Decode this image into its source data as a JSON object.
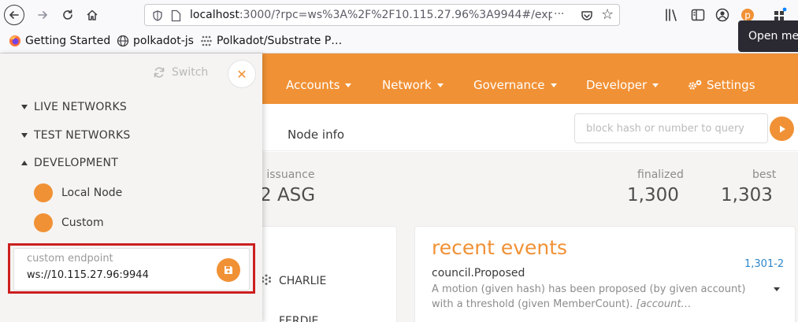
{
  "browser": {
    "url_host": "localhost",
    "url_rest": ":3000/?rpc=ws%3A%2F%2F10.115.27.96%3A9944#/exp",
    "bookmarks": [
      {
        "label": "Getting Started"
      },
      {
        "label": "polkadot-js"
      },
      {
        "label": "Polkadot/Substrate P…"
      }
    ],
    "tooltip": "Open menu"
  },
  "header": {
    "menu": [
      {
        "label": "Accounts"
      },
      {
        "label": "Network"
      },
      {
        "label": "Governance"
      },
      {
        "label": "Developer"
      },
      {
        "label": "Settings"
      }
    ]
  },
  "subbar": {
    "tab": "Node info",
    "search_placeholder": "block hash or number to query"
  },
  "stats": {
    "issuance_label": "l issuance",
    "issuance_value": "2 ASG",
    "finalized_label": "finalized",
    "finalized_value": "1,300",
    "best_label": "best",
    "best_value": "1,303"
  },
  "accounts": [
    "CHARLIE",
    "FERDIE"
  ],
  "events": {
    "title": "recent events",
    "items": [
      {
        "name": "council.Proposed",
        "block": "1,301-2",
        "description": "A motion (given hash) has been proposed (by given account) with a threshold (given MemberCount).",
        "params": "[account…"
      }
    ]
  },
  "panel": {
    "switch_label": "Switch",
    "groups": [
      {
        "label": "LIVE NETWORKS",
        "expanded": false
      },
      {
        "label": "TEST NETWORKS",
        "expanded": false
      },
      {
        "label": "DEVELOPMENT",
        "expanded": true
      }
    ],
    "dev_items": [
      {
        "label": "Local Node"
      },
      {
        "label": "Custom"
      }
    ],
    "endpoint": {
      "label": "custom endpoint",
      "value": "ws://10.115.27.96:9944"
    }
  },
  "colors": {
    "accent": "#f19135",
    "highlight": "#cc1f1f"
  }
}
